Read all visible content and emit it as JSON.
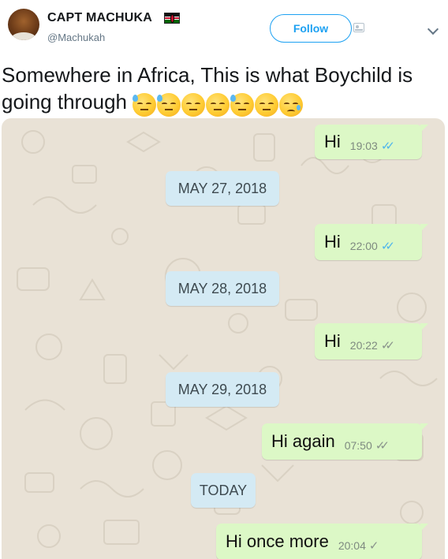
{
  "user": {
    "name": "CAPT MACHUKA",
    "handle": "@Machukah",
    "follow_label": "Follow"
  },
  "tweet": {
    "text": "Somewhere in Africa, This is what Boychild is going through",
    "emojis": [
      "downcast-sweat-face",
      "downcast-sweat-face",
      "unamused-face",
      "unamused-face",
      "downcast-sweat-face",
      "unamused-face",
      "sad-relieved-face"
    ]
  },
  "chat": {
    "messages": [
      {
        "text": "Hi",
        "time": "19:03",
        "status": "read"
      },
      {
        "date": "MAY 27, 2018"
      },
      {
        "text": "Hi",
        "time": "22:00",
        "status": "read"
      },
      {
        "date": "MAY 28, 2018"
      },
      {
        "text": "Hi",
        "time": "20:22",
        "status": "delivered"
      },
      {
        "date": "MAY 29, 2018"
      },
      {
        "text": "Hi again",
        "time": "07:50",
        "status": "delivered"
      },
      {
        "date": "TODAY"
      },
      {
        "text": "Hi once more",
        "time": "20:04",
        "status": "sent"
      }
    ],
    "colors": {
      "background": "#e9e2d6",
      "outgoing": "#dcf8c6",
      "date_pill": "#d4eaf4",
      "read_ticks": "#4fb6ec"
    }
  },
  "flag_icon": "kenya-flag-icon"
}
